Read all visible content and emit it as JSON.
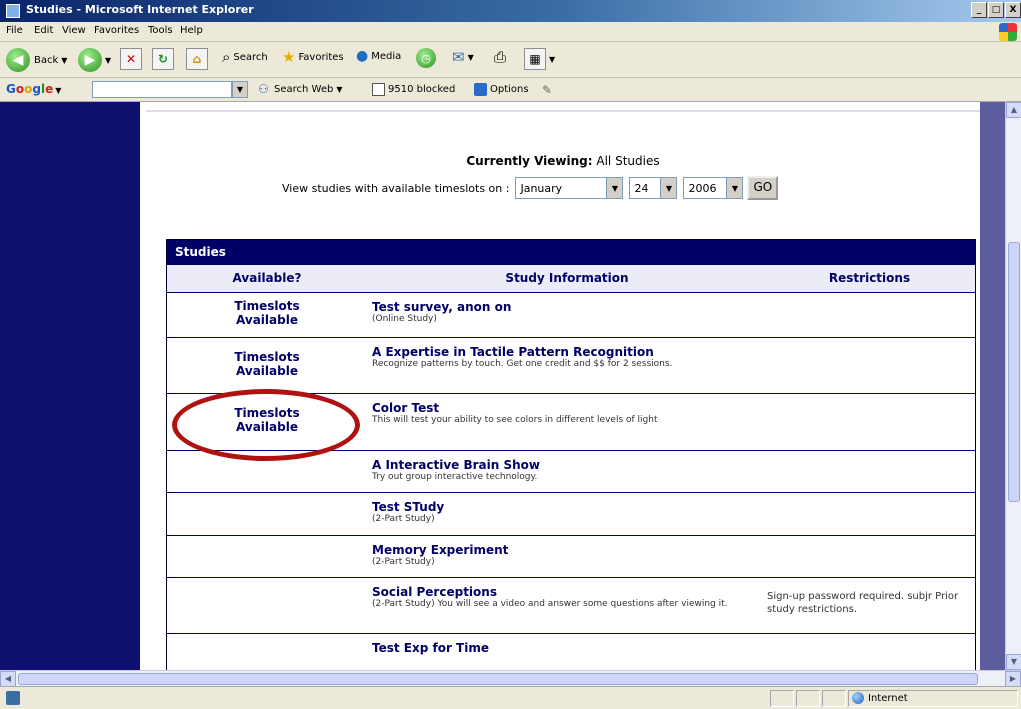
{
  "window": {
    "title": "Studies - Microsoft Internet Explorer",
    "min": "_",
    "max": "□",
    "close": "X"
  },
  "menu": [
    "File",
    "Edit",
    "View",
    "Favorites",
    "Tools",
    "Help"
  ],
  "toolbar": {
    "back": "Back",
    "search": "Search",
    "favorites": "Favorites",
    "media": "Media"
  },
  "google": {
    "logo": "Google",
    "search_web": "Search Web",
    "blocked": "9510 blocked",
    "options": "Options"
  },
  "page": {
    "currently_viewing_label": "Currently Viewing:",
    "currently_viewing_value": "All Studies",
    "filter_label": "View studies with available timeslots on :",
    "month": "January",
    "day": "24",
    "year": "2006",
    "go_label": "GO"
  },
  "studies": {
    "heading": "Studies",
    "columns": [
      "Available?",
      "Study Information",
      "Restrictions"
    ],
    "rows": [
      {
        "available": "Timeslots Available",
        "title": "Test survey, anon on",
        "desc": "(Online Study)",
        "restrictions": ""
      },
      {
        "available": "Timeslots Available",
        "title": "A Expertise in Tactile Pattern Recognition",
        "desc": "Recognize patterns by touch. Get one credit and $$ for 2 sessions.",
        "restrictions": ""
      },
      {
        "available": "Timeslots Available",
        "title": "Color Test",
        "desc": "This will test your ability to see colors in different levels of light",
        "restrictions": ""
      },
      {
        "available": "",
        "title": "A Interactive Brain Show",
        "desc": "Try out group interactive technology.",
        "restrictions": ""
      },
      {
        "available": "",
        "title": "Test STudy",
        "desc": "(2-Part Study)",
        "restrictions": ""
      },
      {
        "available": "",
        "title": "Memory Experiment",
        "desc": "(2-Part Study)",
        "restrictions": ""
      },
      {
        "available": "",
        "title": "Social Perceptions",
        "desc": "(2-Part Study) You will see a video and answer some questions after viewing it.",
        "restrictions": "Sign-up password required. subjr Prior study restrictions."
      },
      {
        "available": "",
        "title": "Test Exp for Time",
        "desc": "",
        "restrictions": ""
      }
    ]
  },
  "status": {
    "zone": "Internet"
  },
  "colors": {
    "nav_dark": "#101070",
    "header_navy": "#000066",
    "highlight_red": "#b01212"
  }
}
